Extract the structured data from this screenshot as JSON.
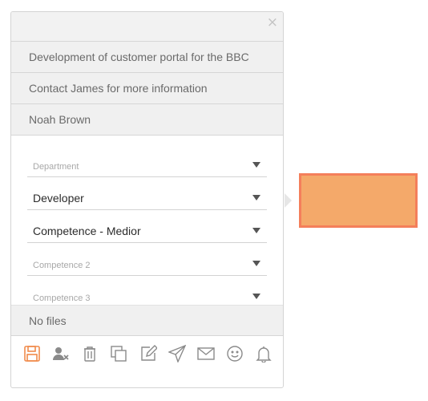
{
  "card": {
    "close_symbol": "×",
    "description": "Development of customer portal for the BBC",
    "note": "Contact James for more information",
    "assignee": "Noah Brown",
    "fields": [
      {
        "name": "department",
        "value": "",
        "placeholder": "Department"
      },
      {
        "name": "role",
        "value": "Developer",
        "placeholder": ""
      },
      {
        "name": "competence-1",
        "value": "Competence - Medior",
        "placeholder": ""
      },
      {
        "name": "competence-2",
        "value": "",
        "placeholder": "Competence 2"
      },
      {
        "name": "competence-3",
        "value": "",
        "placeholder": "Competence 3"
      }
    ],
    "files_label": "No files"
  },
  "toolbar": {
    "icons": [
      "save-icon",
      "remove-user-icon",
      "trash-icon",
      "copy-icon",
      "edit-icon",
      "send-icon",
      "mail-icon",
      "smiley-icon",
      "bell-icon"
    ],
    "icon_color": "#8a8a8a",
    "save_color": "#f08a4b"
  },
  "colors": {
    "accent_box_fill": "#f4a96a",
    "accent_box_border": "#f47f5b"
  }
}
